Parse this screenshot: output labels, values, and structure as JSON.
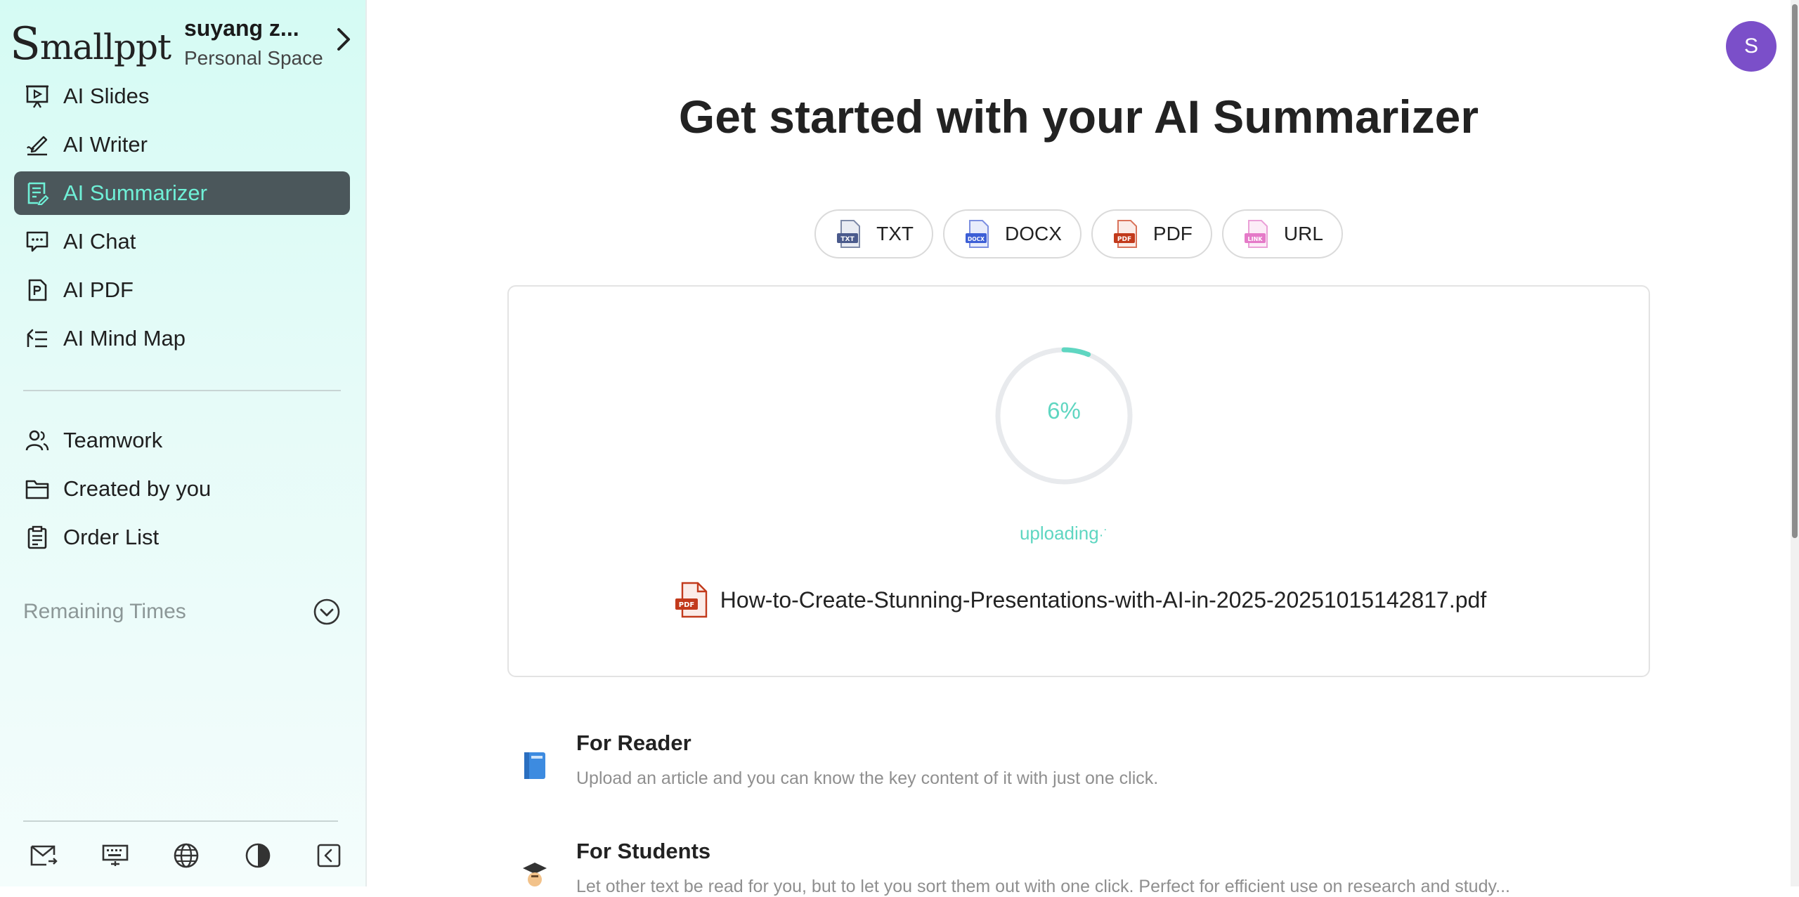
{
  "sidebar": {
    "logo": "Smallppt",
    "account_name": "suyang z...",
    "account_space": "Personal Space",
    "nav_items": [
      {
        "label": "AI Slides",
        "icon": "slides-icon"
      },
      {
        "label": "AI Writer",
        "icon": "writer-icon"
      },
      {
        "label": "AI Summarizer",
        "icon": "summarizer-icon",
        "active": true
      },
      {
        "label": "AI Chat",
        "icon": "chat-icon"
      },
      {
        "label": "AI PDF",
        "icon": "pdf-icon"
      },
      {
        "label": "AI Mind Map",
        "icon": "mind-map-icon"
      }
    ],
    "secondary_items": [
      {
        "label": "Teamwork",
        "icon": "team-icon"
      },
      {
        "label": "Created by you",
        "icon": "folder-icon"
      },
      {
        "label": "Order List",
        "icon": "clipboard-icon"
      }
    ],
    "remaining_label": "Remaining Times",
    "footer_icons": [
      "mail-icon",
      "keyboard-icon",
      "globe-icon",
      "contrast-icon",
      "collapse-icon"
    ]
  },
  "header": {
    "avatar_letter": "S"
  },
  "main": {
    "title": "Get started with your AI Summarizer",
    "file_types": [
      {
        "label": "TXT",
        "icon": "txt-file-icon",
        "color": "#4a5a8c"
      },
      {
        "label": "DOCX",
        "icon": "docx-file-icon",
        "color": "#3d5fd6"
      },
      {
        "label": "PDF",
        "icon": "pdf-file-icon",
        "color": "#c23a1c"
      },
      {
        "label": "URL",
        "icon": "link-file-icon",
        "color": "#e57ac8"
      }
    ],
    "upload": {
      "progress": 0.06,
      "progress_label": "6%",
      "status": "uploading",
      "file_name": "How-to-Create-Stunning-Presentations-with-AI-in-2025-20251015142817.pdf"
    },
    "features": [
      {
        "title": "For Reader",
        "description": "Upload an article and you can know the key content of it with just one click.",
        "icon": "book-emoji-icon"
      },
      {
        "title": "For Students",
        "description": "Let other text be read for you, but to let you sort them out with one click. Perfect for efficient use on research and study...",
        "icon": "student-emoji-icon"
      }
    ]
  },
  "colors": {
    "accent": "#5fd6c1",
    "active_nav_bg": "#4b575b",
    "avatar": "#7b4fc9"
  }
}
